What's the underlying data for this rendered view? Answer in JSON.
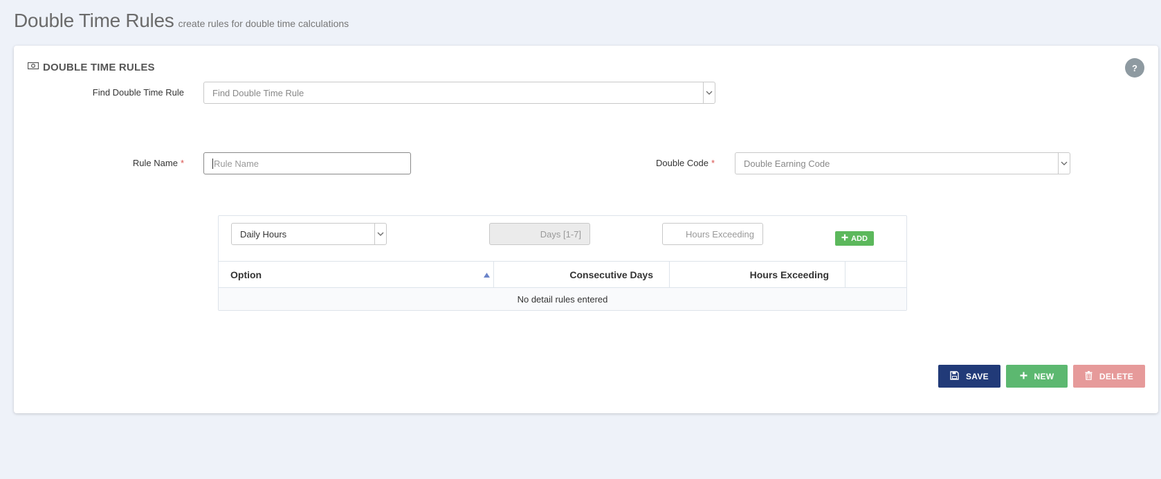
{
  "header": {
    "title": "Double Time Rules",
    "subtitle": "create rules for double time calculations"
  },
  "card": {
    "title": "DOUBLE TIME RULES",
    "help_label": "?"
  },
  "find": {
    "label": "Find Double Time Rule",
    "placeholder": "Find Double Time Rule"
  },
  "rule_name": {
    "label": "Rule Name",
    "required_mark": "*",
    "placeholder": "Rule Name",
    "value": ""
  },
  "double_code": {
    "label": "Double Code",
    "required_mark": "*",
    "placeholder": "Double Earning Code"
  },
  "detail": {
    "option_select": "Daily Hours",
    "days_placeholder": "Days [1-7]",
    "hours_placeholder": "Hours Exceeding",
    "add_label": "ADD",
    "columns": [
      "Option",
      "Consecutive Days",
      "Hours Exceeding",
      ""
    ],
    "empty_message": "No detail rules entered"
  },
  "actions": {
    "save": "SAVE",
    "new": "NEW",
    "delete": "DELETE"
  },
  "colors": {
    "save": "#213a78",
    "new": "#5cb870",
    "delete": "#e69a9a",
    "add": "#5cb85c",
    "required": "#d9534f"
  }
}
